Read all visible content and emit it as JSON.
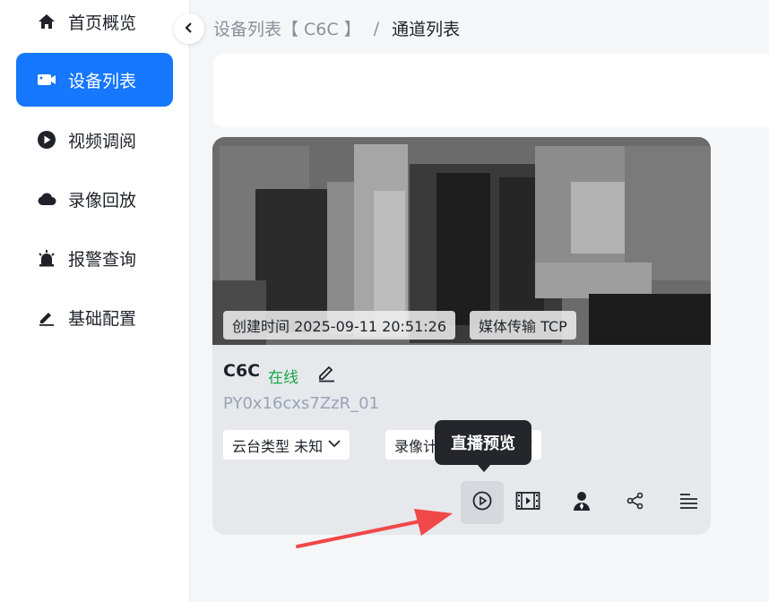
{
  "sidebar": {
    "items": [
      {
        "label": "首页概览",
        "icon": "home-icon",
        "active": false
      },
      {
        "label": "设备列表",
        "icon": "camera-icon",
        "active": true
      },
      {
        "label": "视频调阅",
        "icon": "play-circle-icon",
        "active": false
      },
      {
        "label": "录像回放",
        "icon": "cloud-icon",
        "active": false
      },
      {
        "label": "报警查询",
        "icon": "alarm-icon",
        "active": false
      },
      {
        "label": "基础配置",
        "icon": "pen-icon",
        "active": false
      }
    ]
  },
  "breadcrumb": {
    "parent": "设备列表【 C6C 】",
    "separator": "/",
    "current": "通道列表"
  },
  "channel_card": {
    "created_tag": "创建时间 2025-09-11 20:51:26",
    "transport_tag": "媒体传输 TCP",
    "name": "C6C",
    "status": "在线",
    "channel_id": "PY0x16cxs7ZzR_01",
    "ptz_chip": "云台类型 未知",
    "record_chip": "录像计划",
    "actions": [
      {
        "name": "live-preview-button",
        "icon": "play-circle-icon"
      },
      {
        "name": "playback-button",
        "icon": "film-icon"
      },
      {
        "name": "user-button",
        "icon": "user-icon"
      },
      {
        "name": "share-button",
        "icon": "share-icon"
      },
      {
        "name": "more-button",
        "icon": "list-icon"
      }
    ],
    "tooltip": "直播预览"
  },
  "colors": {
    "accent": "#1677ff",
    "online": "#19a84a",
    "id_text": "#9aa3b5",
    "annotation_arrow": "#f04848"
  }
}
